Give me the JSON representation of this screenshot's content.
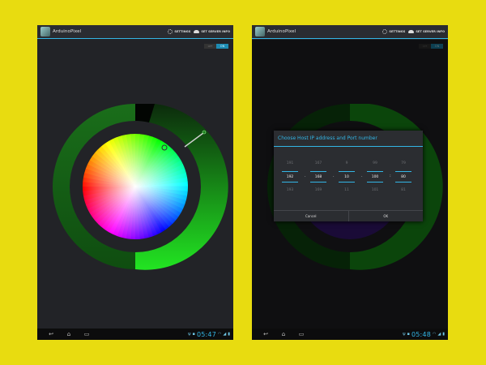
{
  "app": {
    "title": "ArduinoPixel"
  },
  "actions": {
    "settings": "SETTINGS",
    "server": "SET SERVER INFO"
  },
  "toggle": {
    "off": "OFF",
    "on": "ON"
  },
  "left": {
    "clock": "05:47"
  },
  "right": {
    "clock": "05:48",
    "dialog": {
      "title": "Choose Host IP address and Port number",
      "pickers": [
        {
          "prev": "191",
          "cur": "192",
          "next": "193"
        },
        {
          "prev": "167",
          "cur": "168",
          "next": "169"
        },
        {
          "prev": "9",
          "cur": "10",
          "next": "11"
        },
        {
          "prev": "99",
          "cur": "100",
          "next": "101"
        },
        {
          "prev": "79",
          "cur": "80",
          "next": "81"
        }
      ],
      "separators": [
        ".",
        ".",
        ".",
        ":"
      ],
      "cancel": "Cancel",
      "ok": "OK"
    }
  },
  "icons": [
    "app-icon",
    "settings-gear-icon",
    "cloud-icon",
    "back-icon",
    "home-icon",
    "recents-icon",
    "usb-icon",
    "chat-icon",
    "wifi-icon",
    "signal-icon",
    "battery-icon"
  ],
  "colors": {
    "background": "#e8dc10",
    "accent": "#33b5e5",
    "ring": "#19a019",
    "screen": "#222327"
  }
}
